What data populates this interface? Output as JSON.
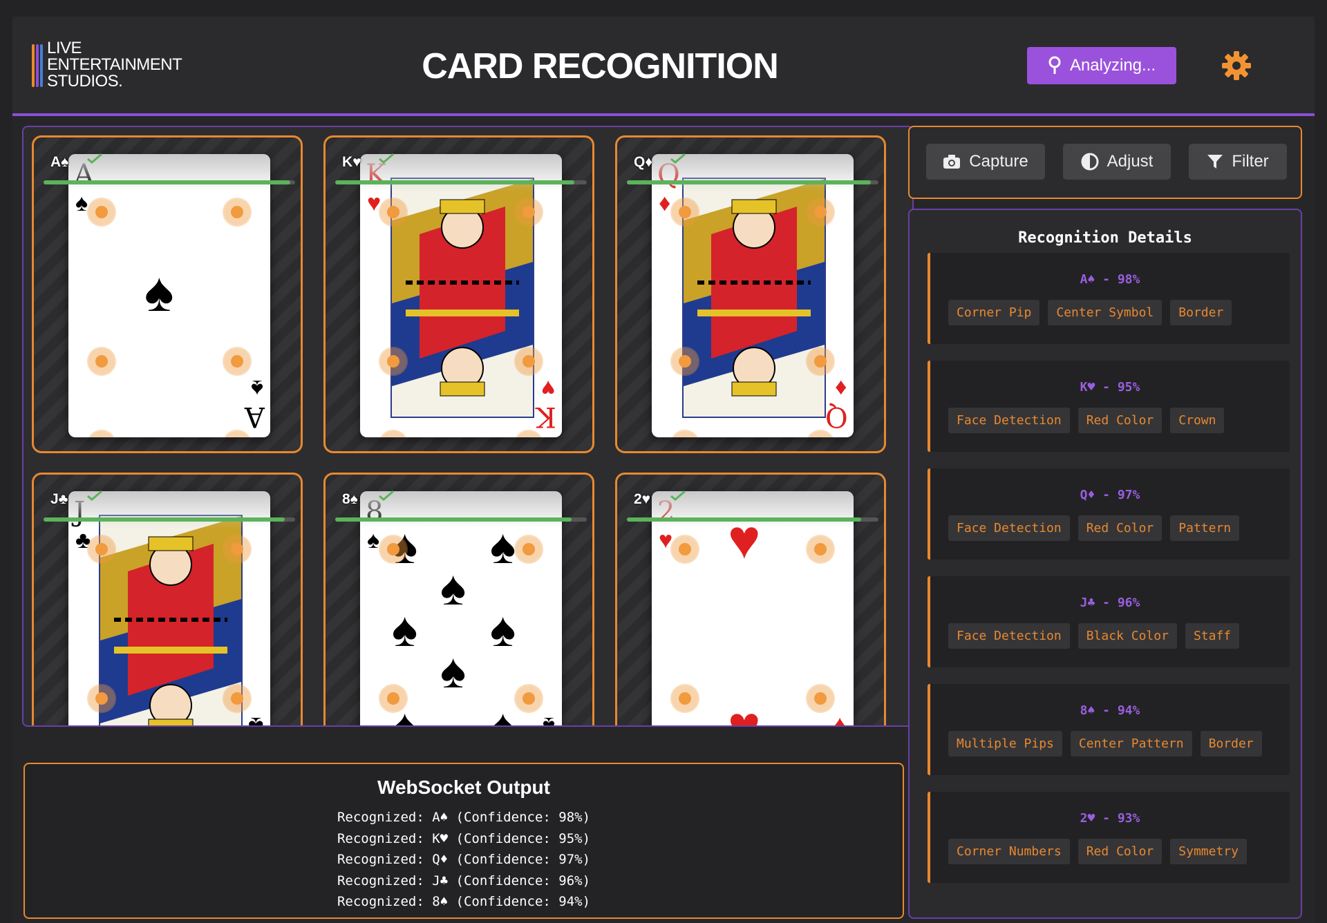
{
  "header": {
    "logo_lines": [
      "LIVE",
      "ENTERTAINMENT",
      "STUDIOS."
    ],
    "title": "CARD RECOGNITION",
    "status_button": "Analyzing...",
    "settings_icon": "gear-icon",
    "accent": "#9a52dc"
  },
  "cards": [
    {
      "label": "A♠",
      "rank": "A",
      "suit": "♠",
      "color": "#000000",
      "confidence": 0.98,
      "kind": "ace"
    },
    {
      "label": "K♥",
      "rank": "K",
      "suit": "♥",
      "color": "#e02020",
      "confidence": 0.95,
      "kind": "face"
    },
    {
      "label": "Q♦",
      "rank": "Q",
      "suit": "♦",
      "color": "#e02020",
      "confidence": 0.97,
      "kind": "face"
    },
    {
      "label": "J♣",
      "rank": "J",
      "suit": "♣",
      "color": "#000000",
      "confidence": 0.96,
      "kind": "face"
    },
    {
      "label": "8♠",
      "rank": "8",
      "suit": "♠",
      "color": "#000000",
      "confidence": 0.94,
      "kind": "pips"
    },
    {
      "label": "2♥",
      "rank": "2",
      "suit": "♥",
      "color": "#e02020",
      "confidence": 0.93,
      "kind": "two"
    }
  ],
  "tools": {
    "capture": "Capture",
    "adjust": "Adjust",
    "filter": "Filter"
  },
  "details": {
    "title": "Recognition Details",
    "items": [
      {
        "head": "A♠ - 98%",
        "tags": [
          "Corner Pip",
          "Center Symbol",
          "Border"
        ]
      },
      {
        "head": "K♥ - 95%",
        "tags": [
          "Face Detection",
          "Red Color",
          "Crown"
        ]
      },
      {
        "head": "Q♦ - 97%",
        "tags": [
          "Face Detection",
          "Red Color",
          "Pattern"
        ]
      },
      {
        "head": "J♣ - 96%",
        "tags": [
          "Face Detection",
          "Black Color",
          "Staff"
        ]
      },
      {
        "head": "8♠ - 94%",
        "tags": [
          "Multiple Pips",
          "Center Pattern",
          "Border"
        ]
      },
      {
        "head": "2♥ - 93%",
        "tags": [
          "Corner Numbers",
          "Red Color",
          "Symmetry"
        ]
      }
    ]
  },
  "websocket": {
    "title": "WebSocket Output",
    "lines": [
      "Recognized: A♠ (Confidence: 98%)",
      "Recognized: K♥ (Confidence: 95%)",
      "Recognized: Q♦ (Confidence: 97%)",
      "Recognized: J♣ (Confidence: 96%)",
      "Recognized: 8♠ (Confidence: 94%)"
    ]
  },
  "colors": {
    "orange": "#e8892f",
    "purple": "#6a3fa6",
    "confidence_green": "#5bb35b"
  }
}
